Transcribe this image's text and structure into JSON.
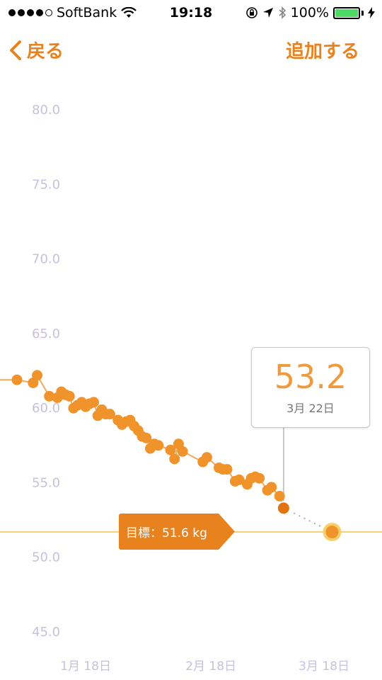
{
  "status_bar": {
    "carrier": "SoftBank",
    "time": "19:18",
    "battery": "100%",
    "battery_level": 1.0
  },
  "nav": {
    "back_label": "戻る",
    "add_label": "追加する"
  },
  "callout": {
    "value": "53.2",
    "date": "3月 22日"
  },
  "goal": {
    "label": "目標：51.6 kg"
  },
  "colors": {
    "accent": "#e8821e",
    "point": "#f0932b",
    "line": "#f2a95a",
    "goal_line": "#f5c042",
    "axis_text": "#c8c0dc"
  },
  "chart_data": {
    "type": "line",
    "ylim": [
      45,
      80
    ],
    "yticks": [
      "80.0",
      "75.0",
      "70.0",
      "65.0",
      "60.0",
      "55.0",
      "50.0",
      "45.0"
    ],
    "ytick_values": [
      80,
      75,
      70,
      65,
      60,
      55,
      50,
      45
    ],
    "xlim": [
      0,
      83
    ],
    "xticks": [
      "1月 18日",
      "2月 18日",
      "3月 18日"
    ],
    "xtick_values": [
      17,
      48,
      76
    ],
    "goal": 51.6,
    "series": [
      {
        "values": [
          [
            0,
            61.8
          ],
          [
            4,
            61.6
          ],
          [
            5,
            62.1
          ],
          [
            8,
            60.7
          ],
          [
            10,
            60.6
          ],
          [
            11,
            61.0
          ],
          [
            12,
            60.8
          ],
          [
            13,
            60.7
          ],
          [
            14,
            59.9
          ],
          [
            15,
            60.1
          ],
          [
            16,
            60.3
          ],
          [
            17,
            60.0
          ],
          [
            18,
            60.2
          ],
          [
            19,
            60.3
          ],
          [
            20,
            59.4
          ],
          [
            21,
            59.8
          ],
          [
            22,
            59.5
          ],
          [
            23,
            59.5
          ],
          [
            25,
            59.1
          ],
          [
            26,
            58.8
          ],
          [
            27,
            59.0
          ],
          [
            28,
            59.1
          ],
          [
            29,
            58.7
          ],
          [
            30,
            58.4
          ],
          [
            31,
            58.0
          ],
          [
            32,
            57.9
          ],
          [
            33,
            57.2
          ],
          [
            34,
            57.5
          ],
          [
            35,
            57.4
          ],
          [
            38,
            57.1
          ],
          [
            39,
            56.5
          ],
          [
            40,
            57.5
          ],
          [
            41,
            57.0
          ],
          [
            46,
            56.3
          ],
          [
            47,
            56.6
          ],
          [
            50,
            55.9
          ],
          [
            51,
            55.8
          ],
          [
            52,
            55.8
          ],
          [
            54,
            55.0
          ],
          [
            55,
            55.1
          ],
          [
            57,
            54.8
          ],
          [
            58,
            55.2
          ],
          [
            59,
            55.3
          ],
          [
            60,
            55.2
          ],
          [
            62,
            54.4
          ],
          [
            63,
            54.6
          ],
          [
            65,
            54.0
          ]
        ]
      },
      {
        "values": [
          [
            66,
            53.2
          ]
        ]
      },
      {
        "values": [
          [
            78,
            51.6
          ]
        ]
      }
    ]
  }
}
